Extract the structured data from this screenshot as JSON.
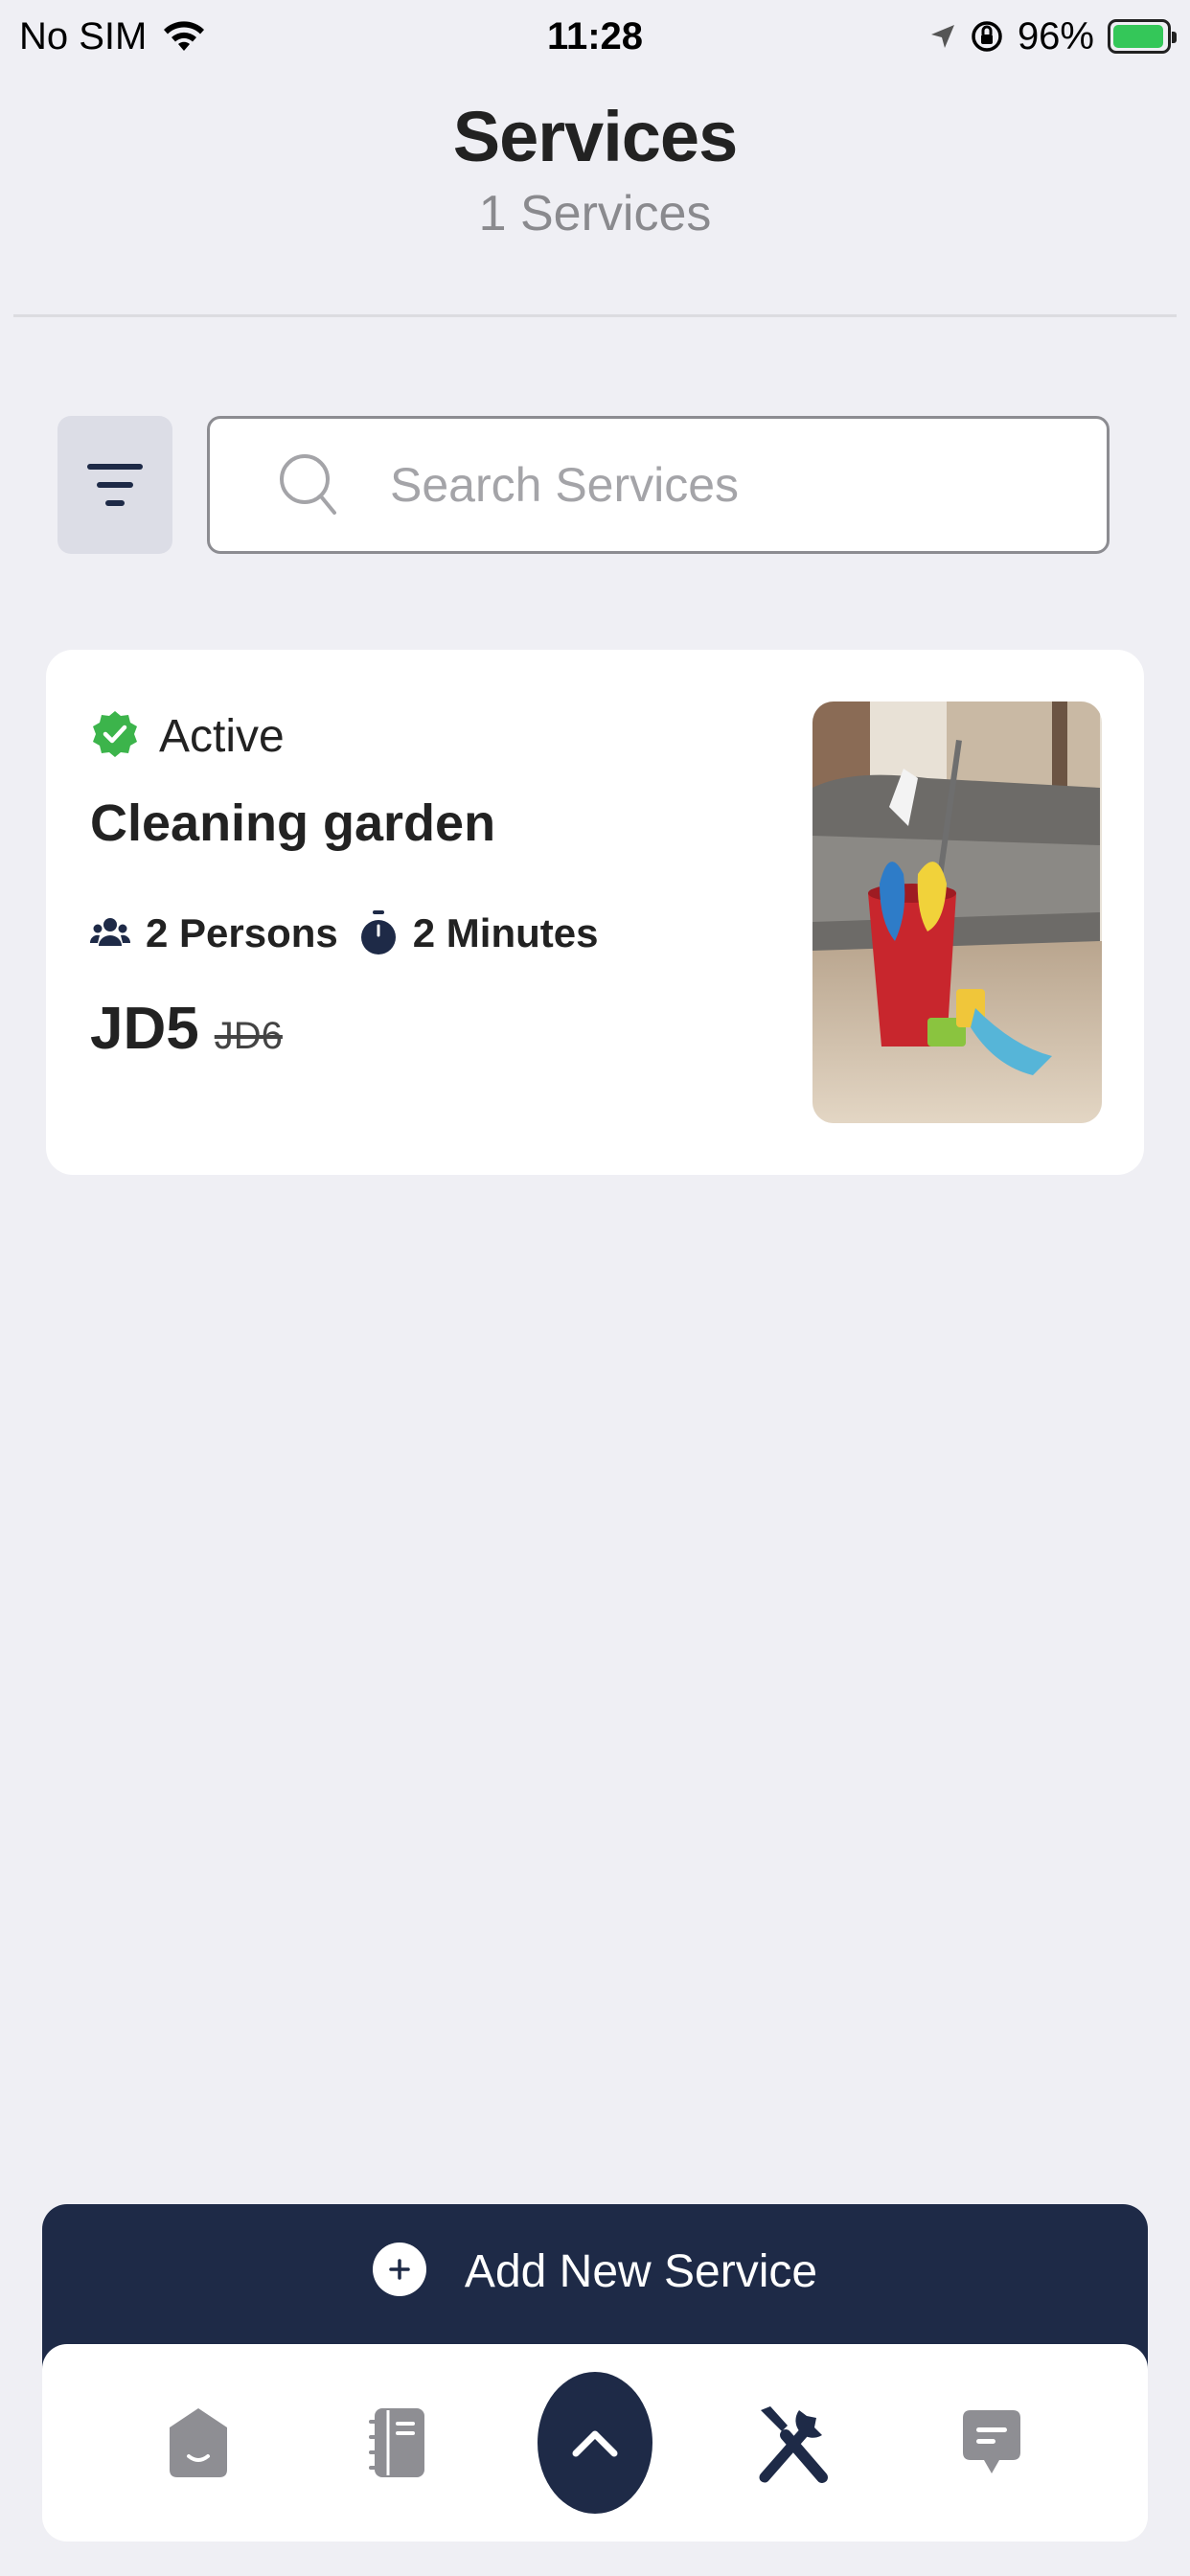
{
  "status_bar": {
    "carrier": "No SIM",
    "time": "11:28",
    "battery": "96%",
    "battery_level": 0.96
  },
  "header": {
    "title": "Services",
    "subtitle": "1 Services"
  },
  "search": {
    "placeholder": "Search Services"
  },
  "services": [
    {
      "status": "Active",
      "name": "Cleaning garden",
      "persons": "2 Persons",
      "duration": "2 Minutes",
      "price": "JD5",
      "old_price": "JD6"
    }
  ],
  "add_button": {
    "label": "Add New Service"
  },
  "tab_bar": {
    "items": [
      "home-icon",
      "notebook-icon",
      "chevron-up-icon",
      "tools-icon",
      "chat-icon"
    ],
    "active": "tools-icon"
  },
  "colors": {
    "accent": "#1e2a47",
    "active_status": "#3cb44b",
    "background": "#efeff4"
  }
}
